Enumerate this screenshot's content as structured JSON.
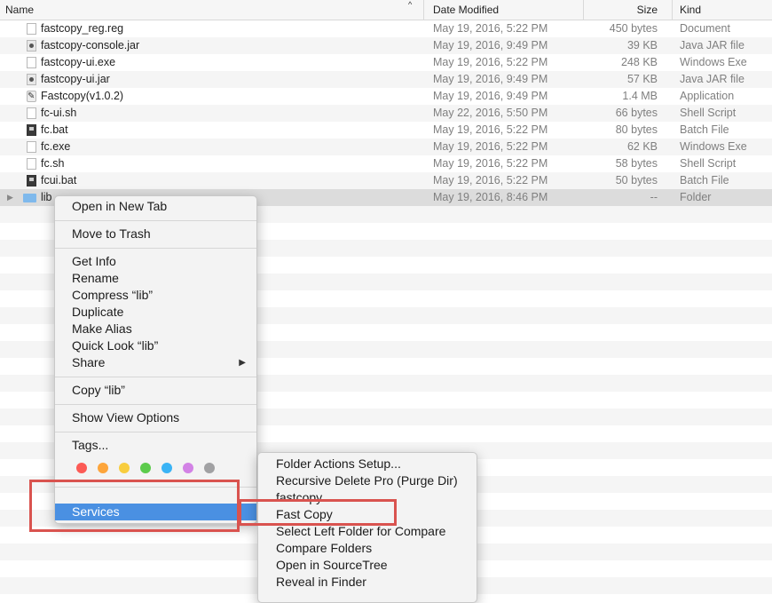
{
  "columns": {
    "name": "Name",
    "date_modified": "Date Modified",
    "size": "Size",
    "kind": "Kind"
  },
  "sort_indicator": "^",
  "files": [
    {
      "name": "fastcopy_reg.reg",
      "date": "May 19, 2016, 5:22 PM",
      "size": "450 bytes",
      "kind": "Document",
      "icon": "document-icon"
    },
    {
      "name": "fastcopy-console.jar",
      "date": "May 19, 2016, 9:49 PM",
      "size": "39 KB",
      "kind": "Java JAR file",
      "icon": "jar-icon"
    },
    {
      "name": "fastcopy-ui.exe",
      "date": "May 19, 2016, 5:22 PM",
      "size": "248 KB",
      "kind": "Windows Exe",
      "icon": "document-icon"
    },
    {
      "name": "fastcopy-ui.jar",
      "date": "May 19, 2016, 9:49 PM",
      "size": "57 KB",
      "kind": "Java JAR file",
      "icon": "jar-icon"
    },
    {
      "name": "Fastcopy(v1.0.2)",
      "date": "May 19, 2016, 9:49 PM",
      "size": "1.4 MB",
      "kind": "Application",
      "icon": "application-icon"
    },
    {
      "name": "fc-ui.sh",
      "date": "May 22, 2016, 5:50 PM",
      "size": "66 bytes",
      "kind": "Shell Script",
      "icon": "document-icon"
    },
    {
      "name": "fc.bat",
      "date": "May 19, 2016, 5:22 PM",
      "size": "80 bytes",
      "kind": "Batch File",
      "icon": "terminal-icon"
    },
    {
      "name": "fc.exe",
      "date": "May 19, 2016, 5:22 PM",
      "size": "62 KB",
      "kind": "Windows Exe",
      "icon": "document-icon"
    },
    {
      "name": "fc.sh",
      "date": "May 19, 2016, 5:22 PM",
      "size": "58 bytes",
      "kind": "Shell Script",
      "icon": "document-icon"
    },
    {
      "name": "fcui.bat",
      "date": "May 19, 2016, 5:22 PM",
      "size": "50 bytes",
      "kind": "Batch File",
      "icon": "terminal-icon"
    },
    {
      "name": "lib",
      "date": "May 19, 2016, 8:46 PM",
      "size": "--",
      "kind": "Folder",
      "icon": "folder-icon",
      "selected": true
    }
  ],
  "disclosure_triangle": "▶",
  "context_menu": {
    "open_in_new_tab": "Open in New Tab",
    "move_to_trash": "Move to Trash",
    "get_info": "Get Info",
    "rename": "Rename",
    "compress": "Compress “lib”",
    "duplicate": "Duplicate",
    "make_alias": "Make Alias",
    "quick_look": "Quick Look “lib”",
    "share": "Share",
    "share_arrow": "▶",
    "copy": "Copy “lib”",
    "show_view_options": "Show View Options",
    "tags": "Tags...",
    "tag_colors": [
      "#fc5a55",
      "#fda53b",
      "#f8cd3e",
      "#5ccb4c",
      "#3ab3f5",
      "#d282e5",
      "#a1a1a3"
    ],
    "services": "Services"
  },
  "services_menu": {
    "items": [
      "Folder Actions Setup...",
      "Recursive Delete Pro (Purge Dir)",
      "fastcopy",
      "Fast Copy",
      "Select Left Folder for Compare",
      "Compare Folders",
      "Open in SourceTree",
      "Reveal in Finder"
    ]
  },
  "colors": {
    "highlight": "#4a90e2",
    "annotation": "#d9534f"
  }
}
